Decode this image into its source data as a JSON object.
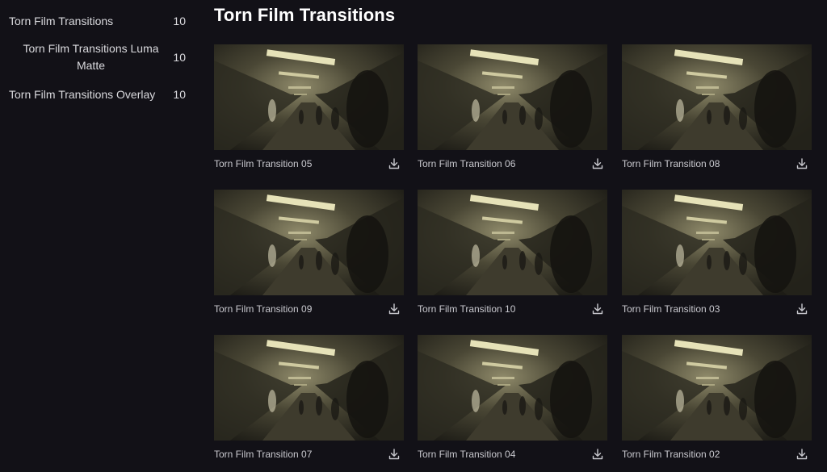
{
  "sidebar": {
    "items": [
      {
        "label": "Torn Film Transitions",
        "count": "10"
      },
      {
        "label": "Torn Film Transitions Luma Matte",
        "count": "10"
      },
      {
        "label": "Torn Film Transitions Overlay",
        "count": "10"
      }
    ]
  },
  "main": {
    "title": "Torn Film Transitions",
    "cards": [
      {
        "label": "Torn Film Transition 05",
        "download_icon": "download-icon"
      },
      {
        "label": "Torn Film Transition 06",
        "download_icon": "download-icon"
      },
      {
        "label": "Torn Film Transition 08",
        "download_icon": "download-icon"
      },
      {
        "label": "Torn Film Transition 09",
        "download_icon": "download-icon"
      },
      {
        "label": "Torn Film Transition 10",
        "download_icon": "download-icon"
      },
      {
        "label": "Torn Film Transition 03",
        "download_icon": "download-icon"
      },
      {
        "label": "Torn Film Transition 07",
        "download_icon": "download-icon"
      },
      {
        "label": "Torn Film Transition 04",
        "download_icon": "download-icon"
      },
      {
        "label": "Torn Film Transition 02",
        "download_icon": "download-icon"
      }
    ]
  },
  "colors": {
    "background": "#121117",
    "title": "#ffffff",
    "text": "#d6d6da"
  }
}
